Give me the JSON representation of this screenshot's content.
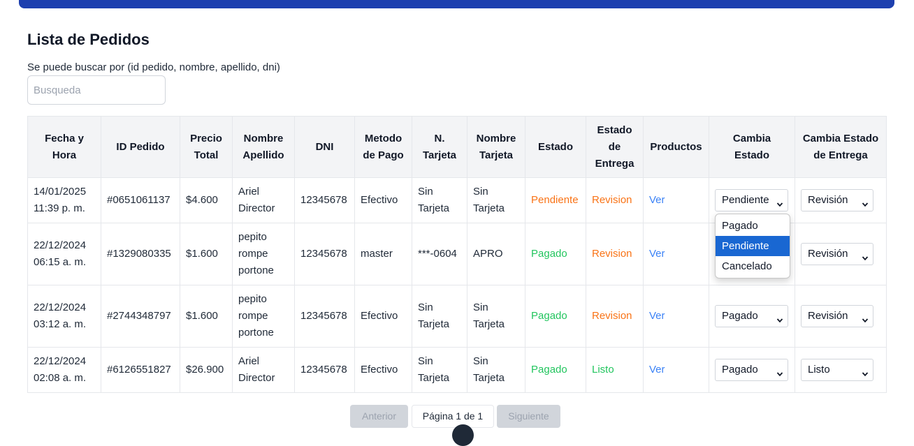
{
  "page": {
    "title": "Lista de Pedidos",
    "search_hint": "Se puede buscar por (id pedido, nombre, apellido, dni)",
    "search_placeholder": "Busqueda"
  },
  "colors": {
    "banner": "#1e40af",
    "status_pending": "#f97316",
    "status_paid": "#22c55e",
    "link": "#3b82f6",
    "dropdown_selected": "#1967d2"
  },
  "table": {
    "headers": [
      [
        "Fecha y",
        "Hora"
      ],
      [
        "ID Pedido"
      ],
      [
        "Precio",
        "Total"
      ],
      [
        "Nombre",
        "Apellido"
      ],
      [
        "DNI"
      ],
      [
        "Metodo",
        "de Pago"
      ],
      [
        "N.",
        "Tarjeta"
      ],
      [
        "Nombre",
        "Tarjeta"
      ],
      [
        "Estado"
      ],
      [
        "Estado",
        "de",
        "Entrega"
      ],
      [
        "Productos"
      ],
      [
        "Cambia",
        "Estado"
      ],
      [
        "Cambia Estado",
        "de Entrega"
      ]
    ],
    "rows": [
      {
        "fecha": [
          "14/01/2025",
          "11:39 p. m."
        ],
        "id": "#0651061137",
        "precio": "$4.600",
        "nombre": [
          "Ariel",
          "Director"
        ],
        "dni": "12345678",
        "metodo": "Efectivo",
        "n_tarjeta": [
          "Sin",
          "Tarjeta"
        ],
        "nombre_tarjeta": [
          "Sin",
          "Tarjeta"
        ],
        "estado": "Pendiente",
        "entrega": "Revision",
        "productos": "Ver",
        "cambia_estado": "Pendiente",
        "cambia_entrega": "Revisión"
      },
      {
        "fecha": [
          "22/12/2024",
          "06:15 a. m."
        ],
        "id": "#1329080335",
        "precio": "$1.600",
        "nombre": [
          "pepito",
          "rompe",
          "portone"
        ],
        "dni": "12345678",
        "metodo": "master",
        "n_tarjeta": [
          "***-0604"
        ],
        "nombre_tarjeta": [
          "APRO"
        ],
        "estado": "Pagado",
        "entrega": "Revision",
        "productos": "Ver",
        "cambia_estado": "",
        "cambia_entrega": "Revisión"
      },
      {
        "fecha": [
          "22/12/2024",
          "03:12 a. m."
        ],
        "id": "#2744348797",
        "precio": "$1.600",
        "nombre": [
          "pepito",
          "rompe",
          "portone"
        ],
        "dni": "12345678",
        "metodo": "Efectivo",
        "n_tarjeta": [
          "Sin",
          "Tarjeta"
        ],
        "nombre_tarjeta": [
          "Sin",
          "Tarjeta"
        ],
        "estado": "Pagado",
        "entrega": "Revision",
        "productos": "Ver",
        "cambia_estado": "Pagado",
        "cambia_entrega": "Revisión"
      },
      {
        "fecha": [
          "22/12/2024",
          "02:08 a. m."
        ],
        "id": "#6126551827",
        "precio": "$26.900",
        "nombre": [
          "Ariel",
          "Director"
        ],
        "dni": "12345678",
        "metodo": "Efectivo",
        "n_tarjeta": [
          "Sin",
          "Tarjeta"
        ],
        "nombre_tarjeta": [
          "Sin",
          "Tarjeta"
        ],
        "estado": "Pagado",
        "entrega": "Listo",
        "productos": "Ver",
        "cambia_estado": "Pagado",
        "cambia_entrega": "Listo"
      }
    ]
  },
  "dropdown": {
    "options": [
      "Pagado",
      "Pendiente",
      "Cancelado"
    ],
    "selected": "Pendiente"
  },
  "pagination": {
    "prev": "Anterior",
    "info": "Página 1 de 1",
    "next": "Siguiente"
  }
}
